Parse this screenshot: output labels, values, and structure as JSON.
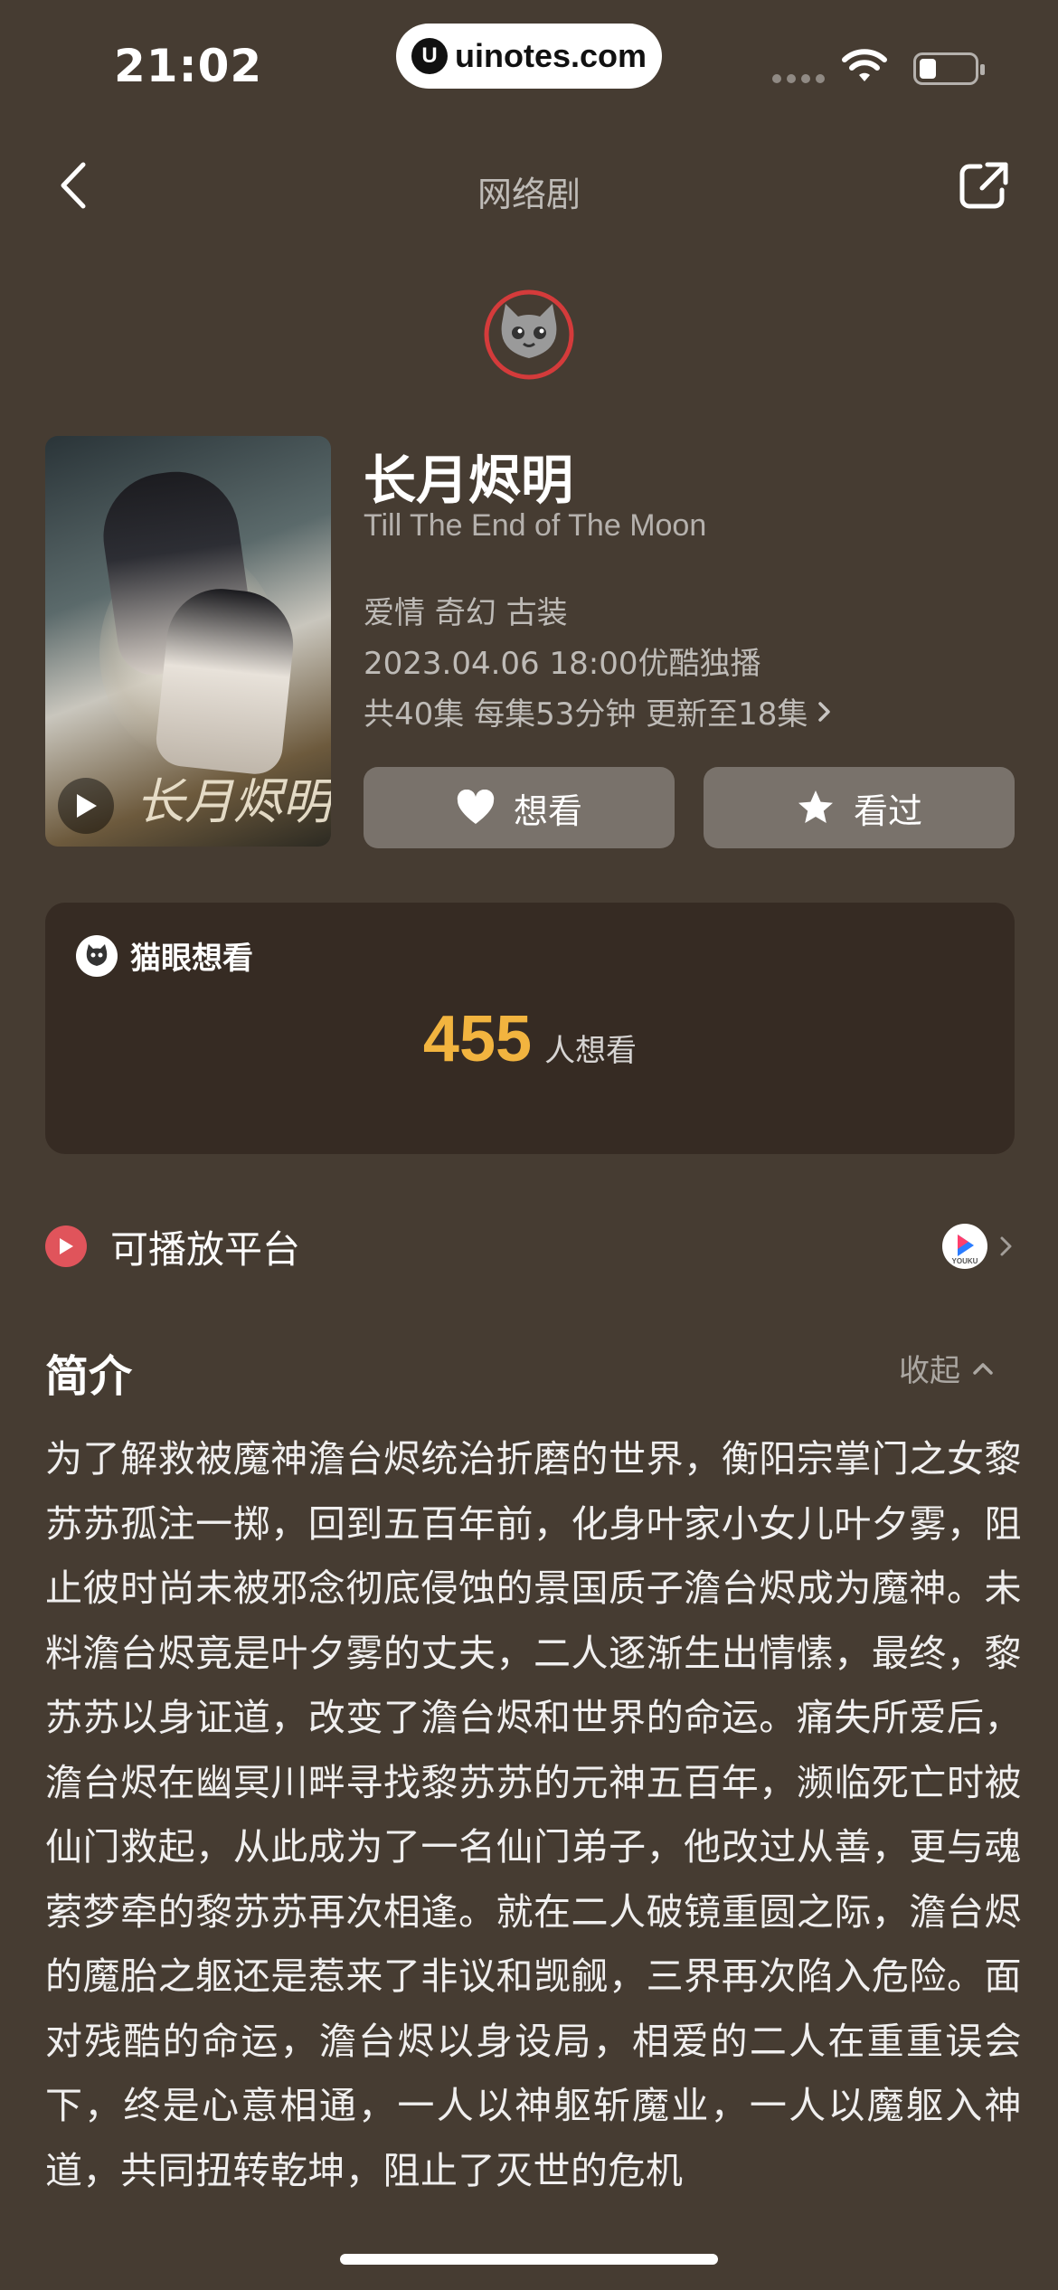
{
  "status_bar": {
    "time": "21:02",
    "url": "uinotes.com"
  },
  "nav": {
    "title": "网络剧",
    "back_icon": "chevron-left-icon",
    "share_icon": "share-icon"
  },
  "movie": {
    "title": "长月烬明",
    "english_title": "Till The End of The Moon",
    "genres": "爱情 奇幻 古装",
    "release": "2023.04.06 18:00优酷独播",
    "episodes": "共40集 每集53分钟 更新至18集",
    "poster_art_text": "长月烬明"
  },
  "actions": {
    "want_label": "想看",
    "seen_label": "看过"
  },
  "want_card": {
    "label": "猫眼想看",
    "count": "455",
    "unit": "人想看"
  },
  "platforms": {
    "label": "可播放平台",
    "logo_text": "YOUKU"
  },
  "synopsis": {
    "title": "简介",
    "collapse_label": "收起",
    "text": "为了解救被魔神澹台烬统治折磨的世界，衡阳宗掌门之女黎苏苏孤注一掷，回到五百年前，化身叶家小女儿叶夕雾，阻止彼时尚未被邪念彻底侵蚀的景国质子澹台烬成为魔神。未料澹台烬竟是叶夕雾的丈夫，二人逐渐生出情愫，最终，黎苏苏以身证道，改变了澹台烬和世界的命运。痛失所爱后，澹台烬在幽冥川畔寻找黎苏苏的元神五百年，濒临死亡时被仙门救起，从此成为了一名仙门弟子，他改过从善，更与魂萦梦牵的黎苏苏再次相逢。就在二人破镜重圆之际，澹台烬的魔胎之躯还是惹来了非议和觊觎，三界再次陷入危险。面对残酷的命运，澹台烬以身设局，相爱的二人在重重误会下，终是心意相通，一人以神躯斩魔业，一人以魔躯入神道，共同扭转乾坤，阻止了灭世的危机"
  },
  "colors": {
    "background": "#463c32",
    "card": "#362b23",
    "accent_count": "#f2b43f",
    "platform_red": "#e0545b"
  }
}
